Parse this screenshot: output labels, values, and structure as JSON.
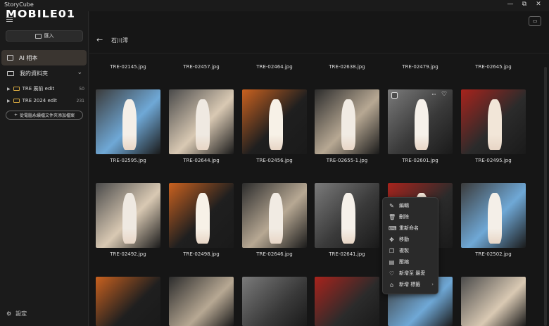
{
  "app": {
    "title": "StoryCube",
    "logo": "MOBILE01"
  },
  "window": {
    "min": "—",
    "max": "⧉",
    "close": "✕"
  },
  "sidebar": {
    "import_label": "匯入",
    "ai_album": "AI 相本",
    "my_folders": "我的資料夾",
    "folders": [
      {
        "name": "TRE 展前 edit",
        "count": "50"
      },
      {
        "name": "TRE 2024 edit",
        "count": "231"
      }
    ],
    "add_folder": "從電腦永續檔文件夾添加檔案",
    "settings": "設定"
  },
  "main": {
    "back": "←",
    "title": "石川澪"
  },
  "rows": [
    {
      "names": [
        "TRE-02145.jpg",
        "TRE-02457.jpg",
        "TRE-02464.jpg",
        "TRE-02638.jpg",
        "TRE-02479.jpg",
        "TRE-02645.jpg"
      ]
    },
    {
      "names": [
        "TRE-02595.jpg",
        "TRE-02644.jpg",
        "TRE-02456.jpg",
        "TRE-02655-1.jpg",
        "TRE-02601.jpg",
        "TRE-02495.jpg"
      ]
    },
    {
      "names": [
        "TRE-02492.jpg",
        "TRE-02498.jpg",
        "TRE-02646.jpg",
        "TRE-02641.jpg",
        "",
        "TRE-02502.jpg"
      ]
    }
  ],
  "context_menu": [
    {
      "icon": "✎",
      "label": "編輯"
    },
    {
      "icon": "🗑",
      "label": "刪除"
    },
    {
      "icon": "⌨",
      "label": "重新命名"
    },
    {
      "icon": "✥",
      "label": "移動"
    },
    {
      "icon": "❐",
      "label": "複製"
    },
    {
      "icon": "▤",
      "label": "壓縮"
    },
    {
      "icon": "♡",
      "label": "新增至 最愛"
    },
    {
      "icon": "⌂",
      "label": "新增 標籤",
      "submenu": "›"
    }
  ],
  "colors": {
    "accent": "#3a3530",
    "bg": "#161616",
    "sidebar": "#1b1b1b"
  }
}
